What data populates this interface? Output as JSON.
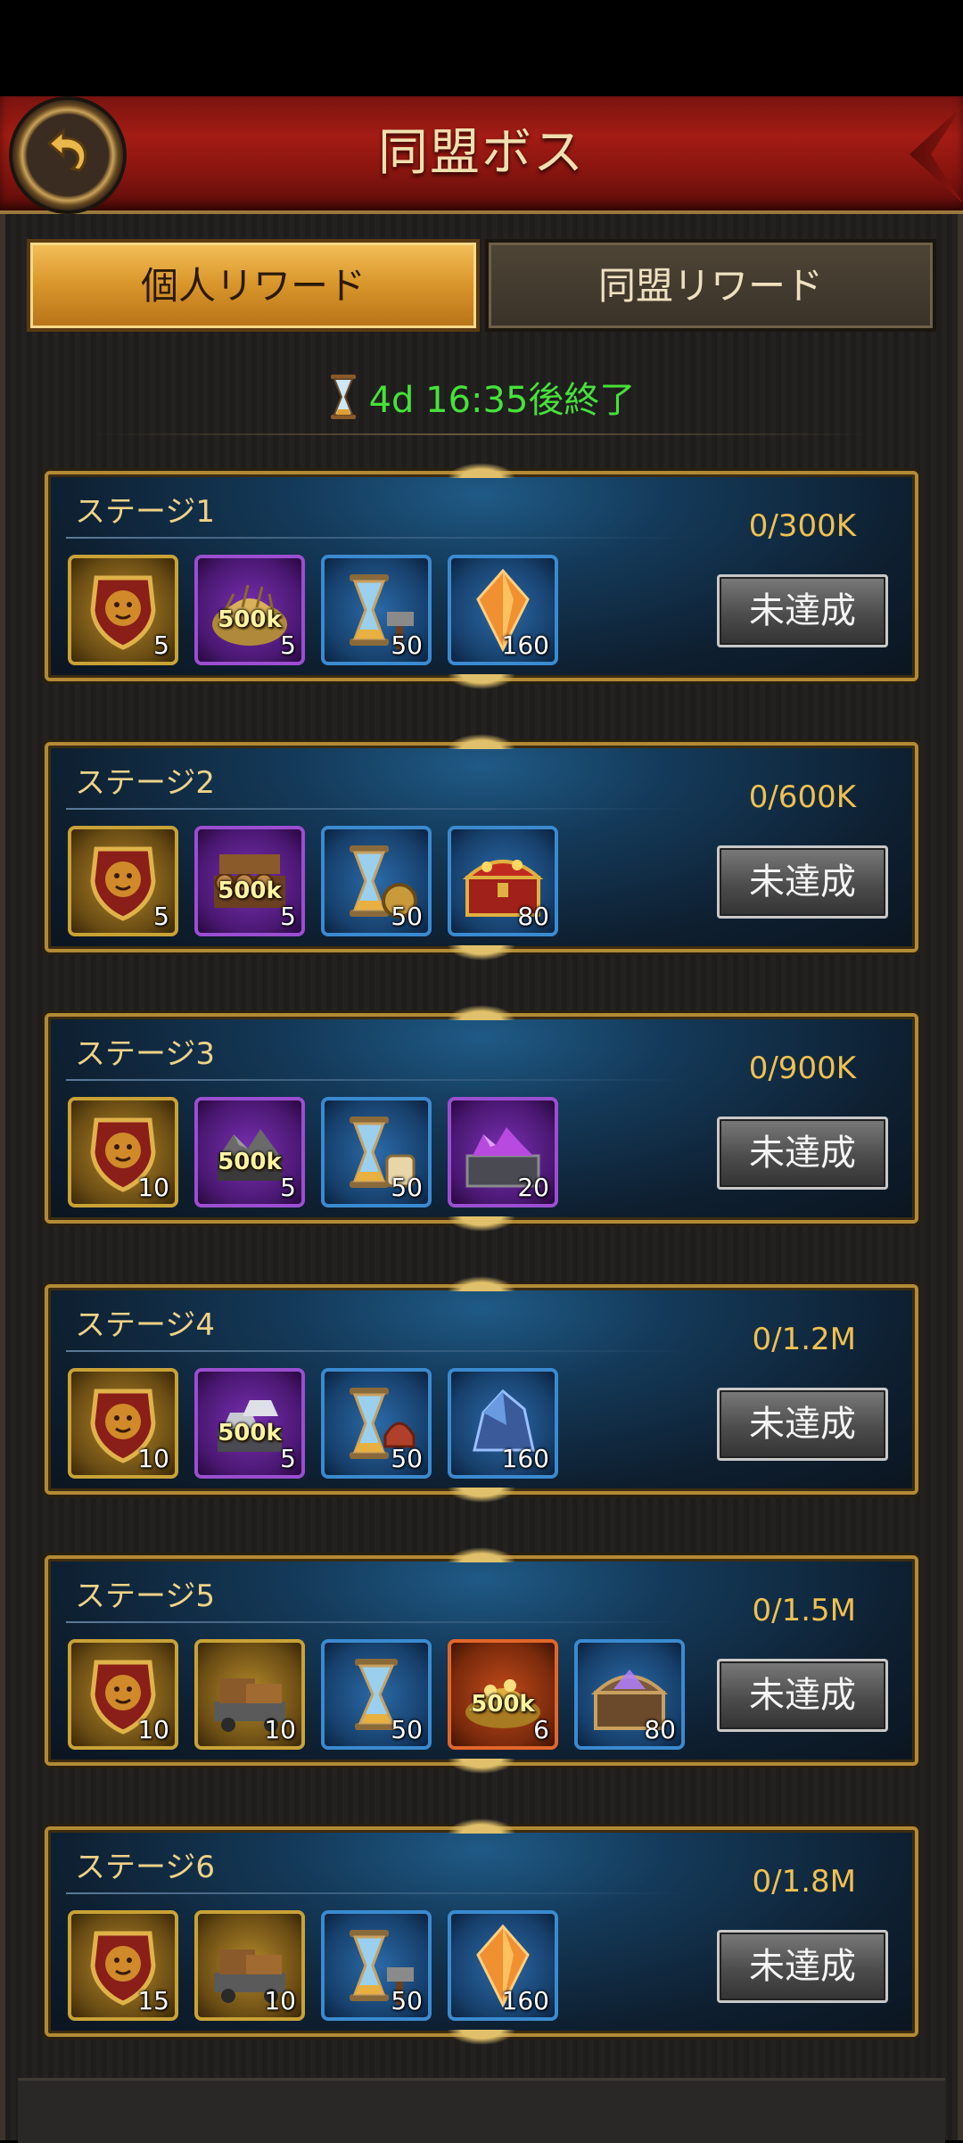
{
  "header": {
    "title": "同盟ボス"
  },
  "tabs": [
    {
      "label": "個人リワード",
      "active": true
    },
    {
      "label": "同盟リワード",
      "active": false
    }
  ],
  "timer": {
    "text": "4d 16:35後終了",
    "color": "#46e23a"
  },
  "stages": [
    {
      "name": "ステージ1",
      "progress": "0/300K",
      "status": "未達成",
      "rewards": [
        {
          "icon": "lion-shield-icon",
          "frame": "gold",
          "qty": "5"
        },
        {
          "icon": "grain-pile-icon",
          "frame": "purple",
          "qty": "5",
          "badge": "500k"
        },
        {
          "icon": "speedup-hourglass-hammer-icon",
          "frame": "blue",
          "qty": "50"
        },
        {
          "icon": "orange-crystal-icon",
          "frame": "blue",
          "qty": "160"
        }
      ]
    },
    {
      "name": "ステージ2",
      "progress": "0/600K",
      "status": "未達成",
      "rewards": [
        {
          "icon": "lion-shield-icon",
          "frame": "gold",
          "qty": "5"
        },
        {
          "icon": "lumber-pile-icon",
          "frame": "purple",
          "qty": "5",
          "badge": "500k"
        },
        {
          "icon": "speedup-hourglass-coin-icon",
          "frame": "blue",
          "qty": "50"
        },
        {
          "icon": "treasure-chest-icon",
          "frame": "blue",
          "qty": "80"
        }
      ]
    },
    {
      "name": "ステージ3",
      "progress": "0/900K",
      "status": "未達成",
      "rewards": [
        {
          "icon": "lion-shield-icon",
          "frame": "gold",
          "qty": "10"
        },
        {
          "icon": "ore-pile-icon",
          "frame": "purple",
          "qty": "5",
          "badge": "500k"
        },
        {
          "icon": "speedup-hourglass-scroll-icon",
          "frame": "blue",
          "qty": "50"
        },
        {
          "icon": "purple-gem-chest-icon",
          "frame": "purple",
          "qty": "20"
        }
      ]
    },
    {
      "name": "ステージ4",
      "progress": "0/1.2M",
      "status": "未達成",
      "rewards": [
        {
          "icon": "lion-shield-icon",
          "frame": "gold",
          "qty": "10"
        },
        {
          "icon": "silver-ingot-pile-icon",
          "frame": "purple",
          "qty": "5",
          "badge": "500k"
        },
        {
          "icon": "speedup-hourglass-helmet-icon",
          "frame": "blue",
          "qty": "50"
        },
        {
          "icon": "blue-crystal-ore-icon",
          "frame": "blue",
          "qty": "160"
        }
      ]
    },
    {
      "name": "ステージ5",
      "progress": "0/1.5M",
      "status": "未達成",
      "rewards": [
        {
          "icon": "lion-shield-icon",
          "frame": "gold",
          "qty": "10"
        },
        {
          "icon": "resource-cart-icon",
          "frame": "gold",
          "qty": "10"
        },
        {
          "icon": "speedup-hourglass-icon",
          "frame": "blue",
          "qty": "50"
        },
        {
          "icon": "gold-coin-pile-icon",
          "frame": "orange",
          "qty": "6",
          "badge": "500k"
        },
        {
          "icon": "mystic-chest-icon",
          "frame": "blue",
          "qty": "80"
        }
      ]
    },
    {
      "name": "ステージ6",
      "progress": "0/1.8M",
      "status": "未達成",
      "rewards": [
        {
          "icon": "lion-shield-icon",
          "frame": "gold",
          "qty": "15"
        },
        {
          "icon": "resource-cart-icon",
          "frame": "gold",
          "qty": "10"
        },
        {
          "icon": "speedup-hourglass-hammer-icon",
          "frame": "blue",
          "qty": "50"
        },
        {
          "icon": "orange-crystal-icon",
          "frame": "blue",
          "qty": "160"
        }
      ]
    }
  ]
}
